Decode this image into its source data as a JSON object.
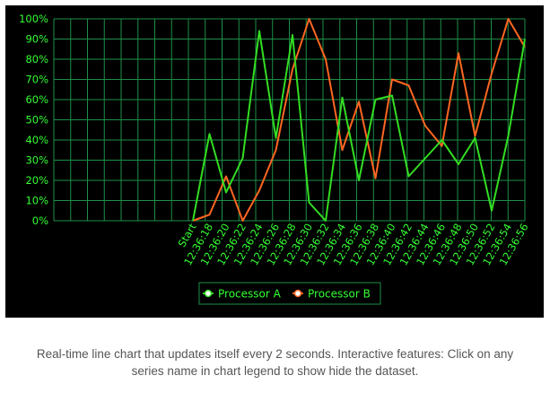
{
  "colors": {
    "background": "#000000",
    "grid": "#1d8f48",
    "text": "#33ff33",
    "processor_a": "#33dd22",
    "processor_b": "#ff6622"
  },
  "caption": {
    "line1": "Real-time line chart that updates itself every 2 seconds. Interactive features: Click on any",
    "line2": "series name in chart legend to show hide the dataset."
  },
  "chart_data": {
    "type": "line",
    "title": "",
    "xlabel": "",
    "ylabel": "",
    "ylim": [
      0,
      100
    ],
    "y_ticks": [
      "0%",
      "10%",
      "20%",
      "30%",
      "40%",
      "50%",
      "60%",
      "70%",
      "80%",
      "90%",
      "100%"
    ],
    "grid": true,
    "legend_position": "bottom-center",
    "categories": [
      "Start",
      "12:36:18",
      "12:36:20",
      "12:36:22",
      "12:36:24",
      "12:36:26",
      "12:36:28",
      "12:36:30",
      "12:36:32",
      "12:36:34",
      "12:36:36",
      "12:36:38",
      "12:36:40",
      "12:36:42",
      "12:36:44",
      "12:36:46",
      "12:36:48",
      "12:36:50",
      "12:36:52",
      "12:36:54",
      "12:36:56"
    ],
    "series": [
      {
        "name": "Processor A",
        "color": "#33dd22",
        "values": [
          0,
          43,
          14,
          31,
          94,
          41,
          92,
          9,
          0,
          61,
          20,
          60,
          62,
          22,
          31,
          40,
          28,
          41,
          5,
          42,
          90
        ]
      },
      {
        "name": "Processor B",
        "color": "#ff6622",
        "values": [
          0,
          3,
          22,
          0,
          15,
          35,
          75,
          100,
          80,
          35,
          59,
          21,
          70,
          67,
          47,
          37,
          83,
          42,
          73,
          100,
          86
        ]
      }
    ]
  }
}
